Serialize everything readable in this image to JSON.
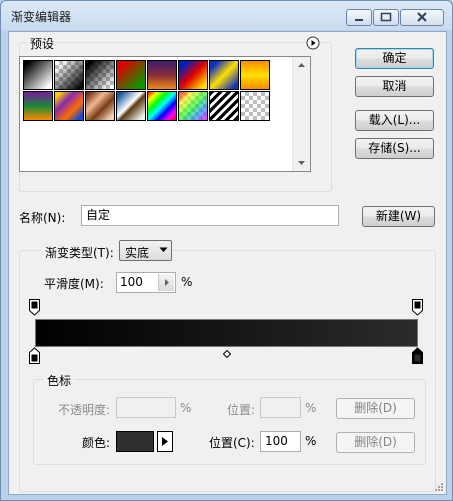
{
  "window": {
    "title": "渐变编辑器"
  },
  "buttons": {
    "ok": "确定",
    "cancel": "取消",
    "load": "载入(L)...",
    "save": "存储(S)...",
    "new": "新建(W)"
  },
  "presets": {
    "label": "预设",
    "swatches": [
      "black-white",
      "checker-black",
      "black-checker",
      "red-green",
      "violet-orange",
      "blue-red-yellow",
      "blue-yellow-blue",
      "orange-yellow-orange",
      "violet-green-orange",
      "yellow-violet-orange-blue",
      "copper",
      "chrome",
      "spectrum",
      "transparent-rainbow",
      "transparent-stripes",
      "checker"
    ]
  },
  "name": {
    "label": "名称(N):",
    "value": "自定"
  },
  "gradient": {
    "type_label": "渐变类型(T):",
    "type_value": "实底",
    "smoothness_label": "平滑度(M):",
    "smoothness_value": "100",
    "smoothness_unit": "%",
    "start_color": "#000000",
    "end_color": "#2b2b2b"
  },
  "stops": {
    "label": "色标",
    "opacity_label": "不透明度:",
    "opacity_value": "",
    "opacity_unit": "%",
    "opacity_location_label": "位置:",
    "opacity_location_value": "",
    "opacity_location_unit": "%",
    "delete_label_1": "删除(D)",
    "color_label": "颜色:",
    "color_value": "#303030",
    "color_location_label": "位置(C):",
    "color_location_value": "100",
    "color_location_unit": "%",
    "delete_label_2": "删除(D)"
  },
  "icons": {
    "menu": "circle-arrow-icon",
    "stepper": "triangle-right-icon"
  }
}
